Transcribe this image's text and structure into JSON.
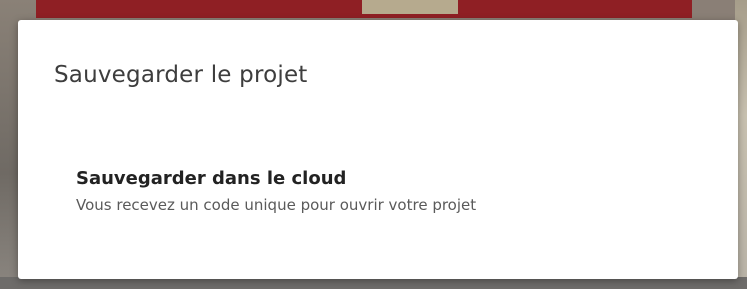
{
  "dialog": {
    "title": "Sauvegarder le projet",
    "options": [
      {
        "label": "Sauvegarder dans le cloud",
        "description": "Vous recevez un code unique pour ouvrir votre projet"
      }
    ]
  },
  "colors": {
    "overlay": "#7f7c78",
    "modal_background": "#ffffff",
    "title_text": "#3d3d3d",
    "option_title_text": "#222222",
    "option_desc_text": "#5a5a5a",
    "background_accent_red": "#8f1f24"
  }
}
